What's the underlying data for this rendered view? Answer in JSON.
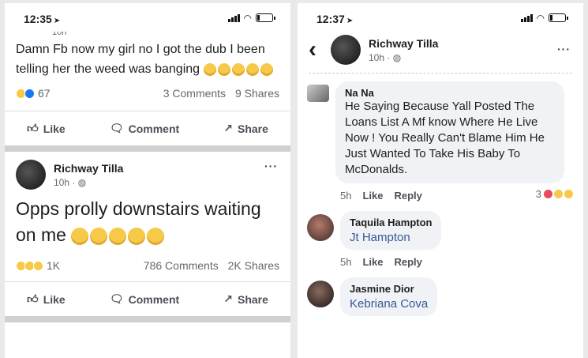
{
  "left": {
    "status_time": "12:35",
    "post1": {
      "truncated_header": "10h",
      "text": "Damn Fb now my girl no I got the dub I been telling her the weed was banging",
      "reaction_count": "67",
      "comments": "3 Comments",
      "shares": "9 Shares"
    },
    "actions": {
      "like": "Like",
      "comment": "Comment",
      "share": "Share"
    },
    "post2": {
      "author": "Richway Tilla",
      "time": "10h · ",
      "more": "···",
      "text": "Opps prolly downstairs waiting on me",
      "reaction_count": "1K",
      "comments": "786 Comments",
      "shares": "2K Shares"
    }
  },
  "right": {
    "status_time": "12:37",
    "back": "‹",
    "author": "Richway Tilla",
    "time": "10h · ",
    "more": "···",
    "comments": [
      {
        "name": "Na Na",
        "text": "He Saying Because Yall Posted The Loans List A Mf know Where He Live Now ! You Really Can't Blame Him He Just Wanted To Take His Baby To McDonalds.",
        "age": "5h",
        "like": "Like",
        "reply": "Reply",
        "reactions": "3"
      },
      {
        "name": "Taquila Hampton",
        "tag": "Jt Hampton",
        "age": "5h",
        "like": "Like",
        "reply": "Reply"
      },
      {
        "name": "Jasmine Dior",
        "tag": "Kebriana Cova"
      }
    ]
  }
}
